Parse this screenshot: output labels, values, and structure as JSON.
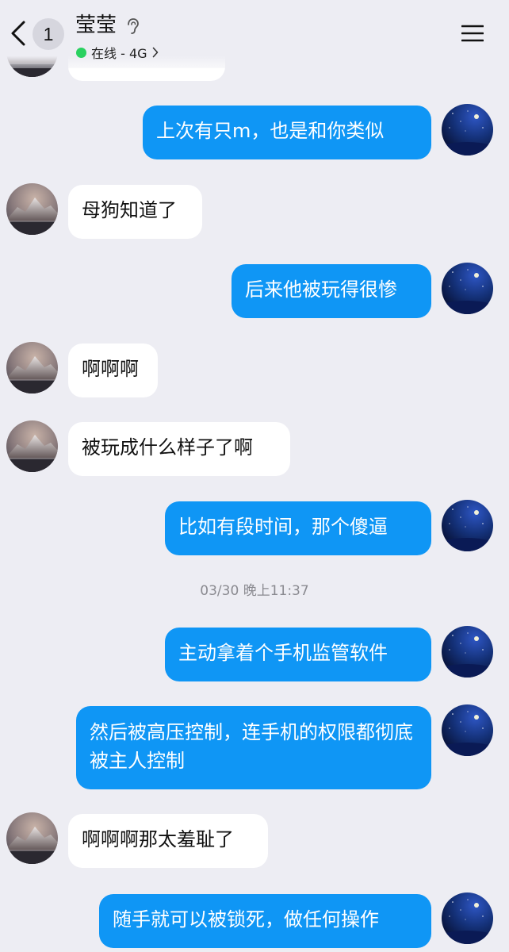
{
  "header": {
    "unread_count": "1",
    "contact_name": "莹莹",
    "status": "在线 - 4G",
    "online_color": "#2ad160",
    "icons": [
      "back-arrow-icon",
      "ear-icon",
      "chevron-right-icon",
      "menu-icon"
    ]
  },
  "colors": {
    "background": "#ededf3",
    "incoming_bubble": "#ffffff",
    "outgoing_bubble": "#0f96f5"
  },
  "messages": [
    {
      "direction": "in",
      "text": ""
    },
    {
      "direction": "out",
      "text": "上次有只m，也是和你类似"
    },
    {
      "direction": "in",
      "text": "母狗知道了"
    },
    {
      "direction": "out",
      "text": "后来他被玩得很惨"
    },
    {
      "direction": "in",
      "text": "啊啊啊"
    },
    {
      "direction": "in",
      "text": "被玩成什么样子了啊"
    },
    {
      "direction": "out",
      "text": "比如有段时间，那个傻逼"
    },
    {
      "direction": "out",
      "text": "主动拿着个手机监管软件"
    },
    {
      "direction": "out",
      "text": "然后被高压控制，连手机的权限都彻底被主人控制"
    },
    {
      "direction": "in",
      "text": "啊啊啊那太羞耻了"
    },
    {
      "direction": "out",
      "text": "随手就可以被锁死，做任何操作"
    }
  ],
  "timestamp": "03/30 晚上11:37"
}
